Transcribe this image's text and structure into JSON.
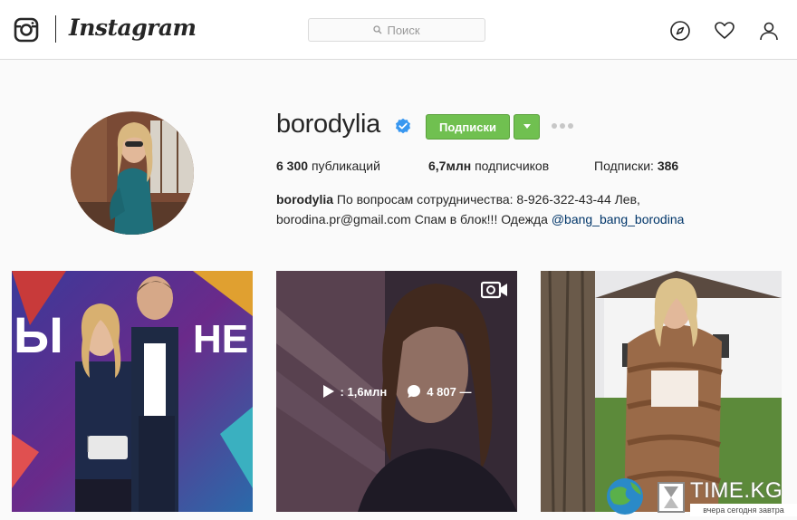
{
  "header": {
    "wordmark": "Instagram",
    "search_placeholder": "Поиск",
    "icons": [
      "instagram-camera-icon",
      "search-icon",
      "compass-icon",
      "heart-icon",
      "user-icon"
    ]
  },
  "profile": {
    "username": "borodylia",
    "verified": true,
    "follow_label": "Подписки",
    "stats": {
      "posts_value": "6 300",
      "posts_label": "публикаций",
      "followers_value": "6,7млн",
      "followers_label": "подписчиков",
      "following_label": "Подписки:",
      "following_value": "386"
    },
    "bio": {
      "name": "borodylia",
      "line1": "По вопросам сотрудничества: 8-926-322-43-44 Лев,",
      "line2": "borodina.pr@gmail.com Спам в блок!!! Одежда",
      "mention": "@bang_bang_borodina"
    }
  },
  "grid": {
    "posts": [
      {
        "type": "photo"
      },
      {
        "type": "video",
        "views": ": 1,6млн",
        "comments": "4 807 —"
      },
      {
        "type": "photo"
      }
    ]
  },
  "watermark": {
    "title": "TIME.KG",
    "subtitle": "вчера сегодня завтра"
  },
  "colors": {
    "accent_green": "#70c050",
    "verified_blue": "#3897f0",
    "link": "#003569",
    "background": "#fafafa"
  }
}
